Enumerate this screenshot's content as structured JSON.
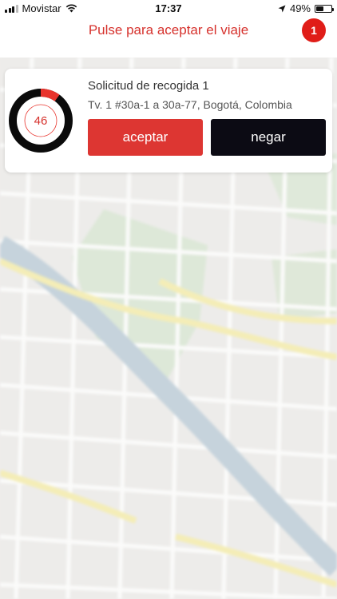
{
  "status_bar": {
    "carrier": "Movistar",
    "time": "17:37",
    "battery": "49%",
    "battery_level": 0.49,
    "icons": [
      "signal-icon",
      "wifi-icon",
      "location-arrow-icon",
      "battery-icon"
    ]
  },
  "header": {
    "title": "Pulse para aceptar el viaje",
    "badge_count": "1"
  },
  "request": {
    "title": "Solicitud de recogida 1",
    "address": "Tv. 1 #30a-1 a 30a-77, Bogotá, Colombia",
    "timer_value": "46",
    "timer_elapsed_fraction": 0.1,
    "accept_label": "aceptar",
    "reject_label": "negar"
  },
  "colors": {
    "accent": "#d6312c",
    "accept_button": "#dd3632",
    "reject_button": "#0c0b14",
    "badge": "#e01d18"
  }
}
